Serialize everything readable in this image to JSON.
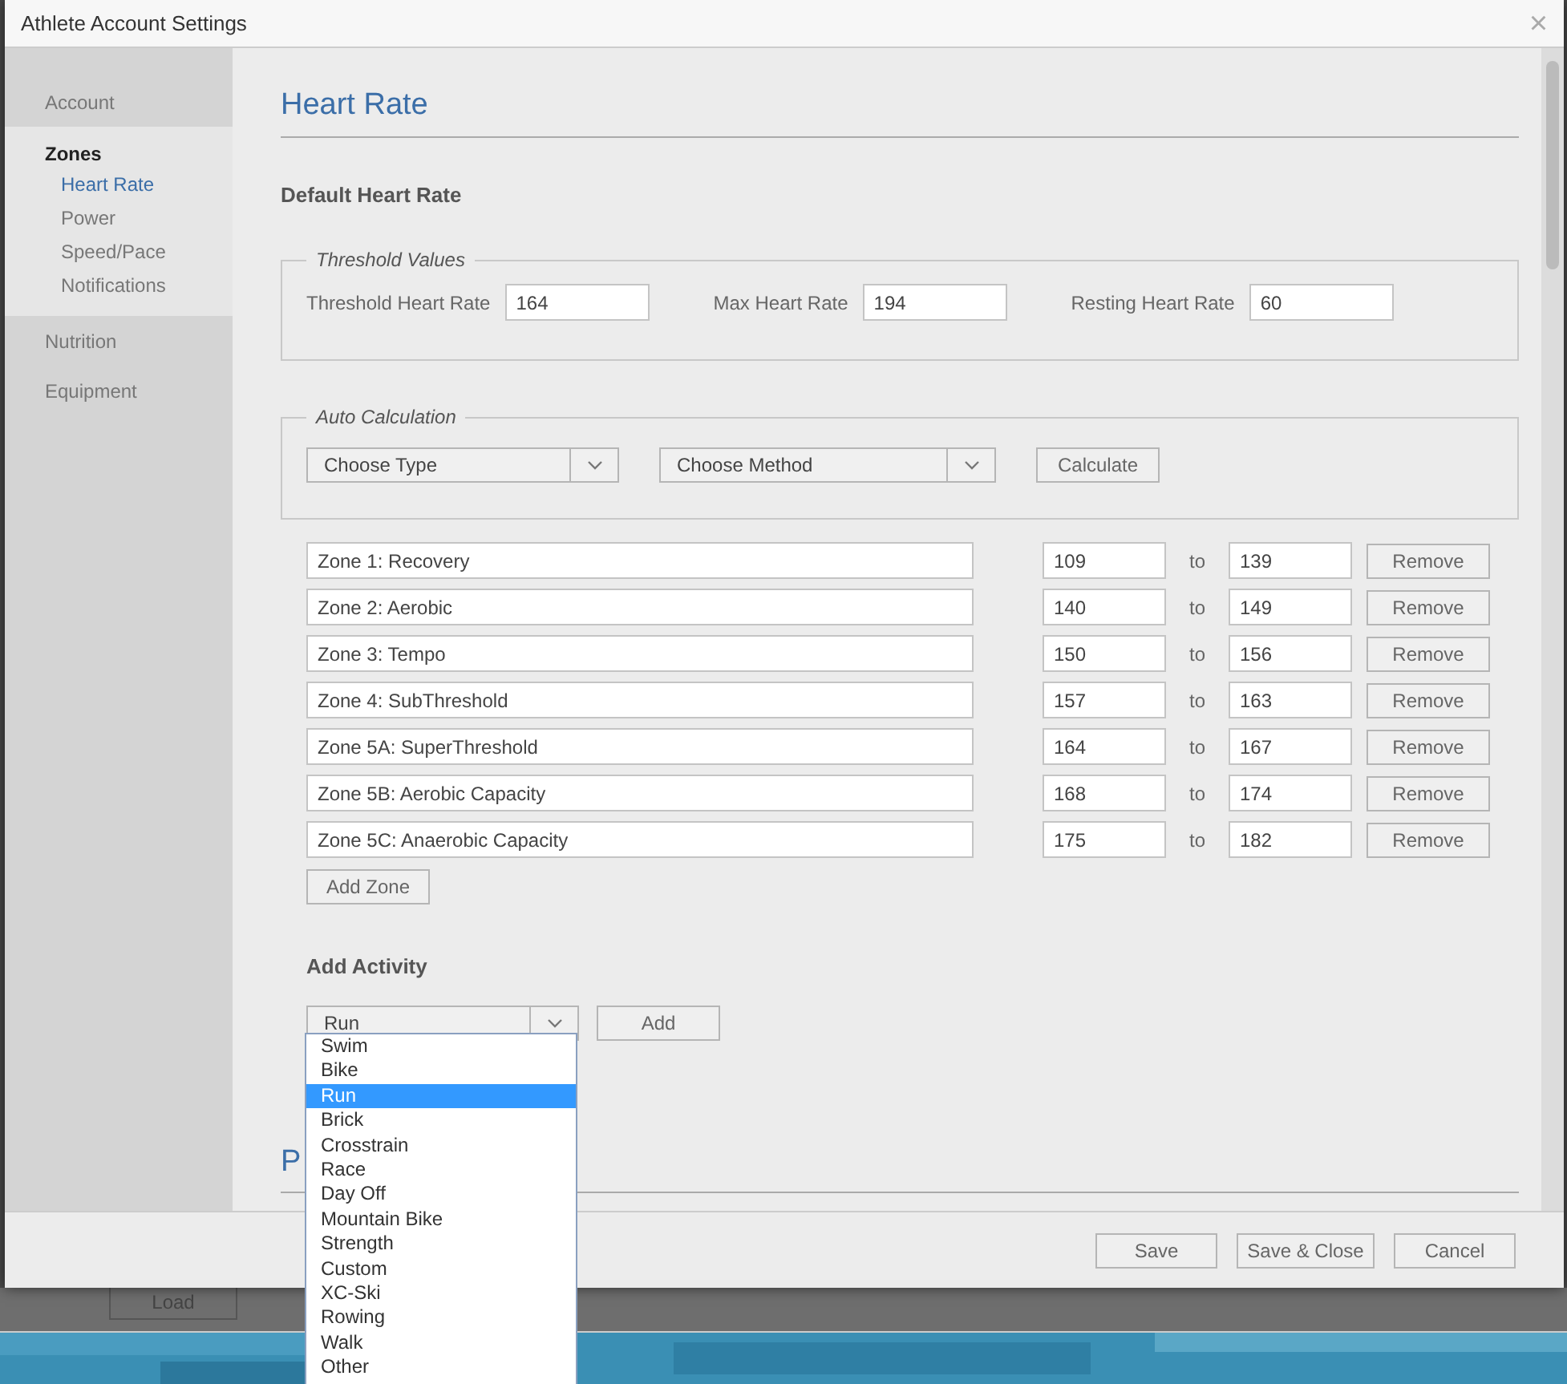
{
  "window": {
    "title": "Athlete Account Settings",
    "close": "×"
  },
  "sidebar": {
    "items": [
      {
        "label": "Account",
        "kind": "section",
        "selected": false
      },
      {
        "label": "Zones",
        "kind": "group",
        "selected": true,
        "children": [
          {
            "label": "Heart Rate",
            "selected": true
          },
          {
            "label": "Power",
            "selected": false
          },
          {
            "label": "Speed/Pace",
            "selected": false
          },
          {
            "label": "Notifications",
            "selected": false
          }
        ]
      },
      {
        "label": "Nutrition",
        "kind": "section",
        "selected": false
      },
      {
        "label": "Equipment",
        "kind": "section",
        "selected": false
      }
    ]
  },
  "heading": "Heart Rate",
  "subheading": "Default Heart Rate",
  "threshold": {
    "legend": "Threshold Values",
    "fields": [
      {
        "label": "Threshold Heart Rate",
        "value": "164"
      },
      {
        "label": "Max Heart Rate",
        "value": "194"
      },
      {
        "label": "Resting Heart Rate",
        "value": "60"
      }
    ]
  },
  "auto_calculation": {
    "legend": "Auto Calculation",
    "type_select": "Choose Type",
    "method_select": "Choose Method",
    "button": "Calculate"
  },
  "zones": [
    {
      "name": "Zone 1: Recovery",
      "from": "109",
      "to_label": "to",
      "to": "139",
      "remove_button": "Remove"
    },
    {
      "name": "Zone 2: Aerobic",
      "from": "140",
      "to_label": "to",
      "to": "149",
      "remove_button": "Remove"
    },
    {
      "name": "Zone 3: Tempo",
      "from": "150",
      "to_label": "to",
      "to": "156",
      "remove_button": "Remove"
    },
    {
      "name": "Zone 4: SubThreshold",
      "from": "157",
      "to_label": "to",
      "to": "163",
      "remove_button": "Remove"
    },
    {
      "name": "Zone 5A: SuperThreshold",
      "from": "164",
      "to_label": "to",
      "to": "167",
      "remove_button": "Remove"
    },
    {
      "name": "Zone 5B: Aerobic Capacity",
      "from": "168",
      "to_label": "to",
      "to": "174",
      "remove_button": "Remove"
    },
    {
      "name": "Zone 5C: Anaerobic Capacity",
      "from": "175",
      "to_label": "to",
      "to": "182",
      "remove_button": "Remove"
    }
  ],
  "add_zone_button": "Add Zone",
  "add_activity": {
    "title": "Add Activity",
    "value": "Run",
    "button": "Add",
    "options": [
      {
        "label": "Swim",
        "selected": false
      },
      {
        "label": "Bike",
        "selected": false
      },
      {
        "label": "Run",
        "selected": true
      },
      {
        "label": "Brick",
        "selected": false
      },
      {
        "label": "Crosstrain",
        "selected": false
      },
      {
        "label": "Race",
        "selected": false
      },
      {
        "label": "Day Off",
        "selected": false
      },
      {
        "label": "Mountain Bike",
        "selected": false
      },
      {
        "label": "Strength",
        "selected": false
      },
      {
        "label": "Custom",
        "selected": false
      },
      {
        "label": "XC-Ski",
        "selected": false
      },
      {
        "label": "Rowing",
        "selected": false
      },
      {
        "label": "Walk",
        "selected": false
      },
      {
        "label": "Other",
        "selected": false
      }
    ]
  },
  "next_heading": "P",
  "footer": {
    "buttons": [
      "Save",
      "Save & Close",
      "Cancel"
    ]
  },
  "background": {
    "button": "Load"
  }
}
